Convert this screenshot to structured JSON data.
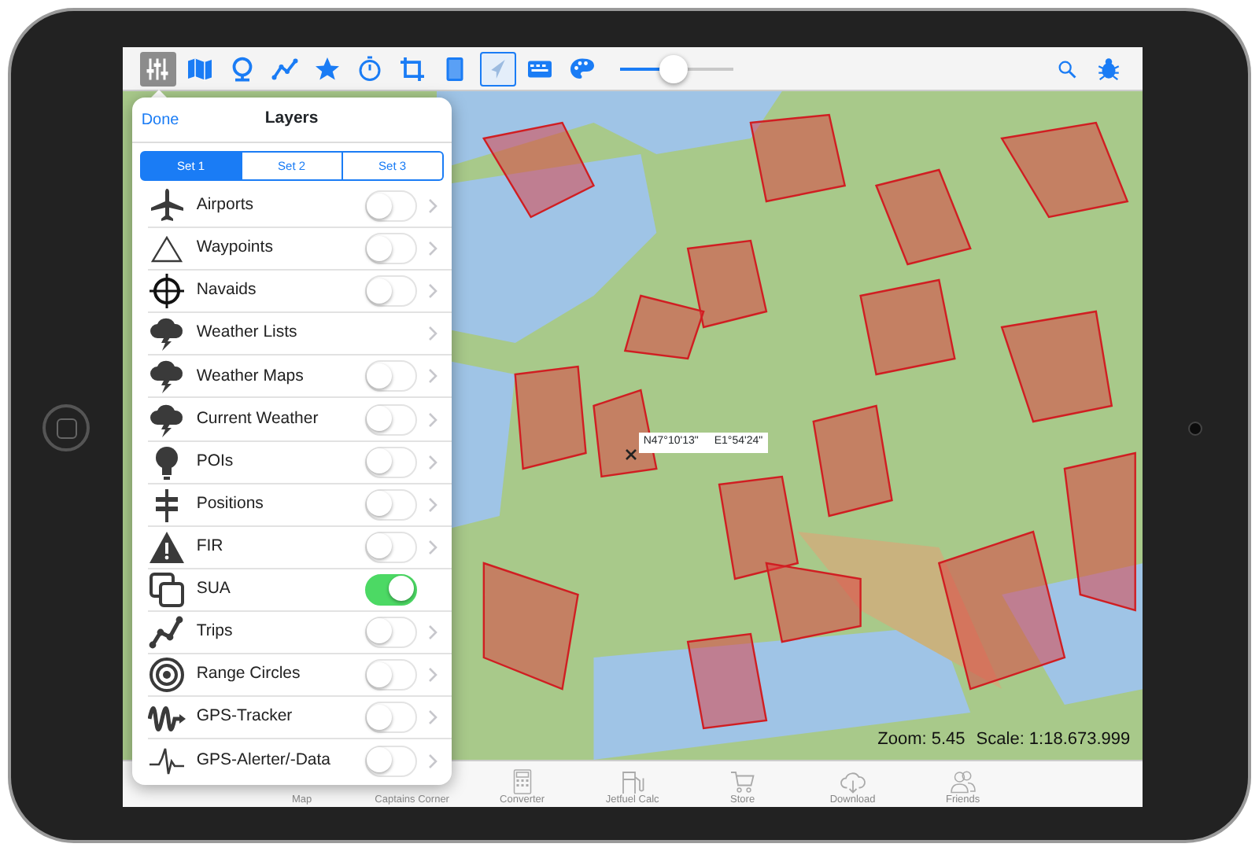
{
  "toolbar": {
    "buttons": [
      {
        "selected": true
      },
      {
        "selected": false
      },
      {
        "selected": false
      },
      {
        "selected": false
      },
      {
        "selected": false
      },
      {
        "selected": false
      },
      {
        "selected": false
      },
      {
        "selected": false
      },
      {
        "selected": true
      },
      {
        "selected": false
      },
      {
        "selected": false
      }
    ],
    "slider": {
      "level": 0.48
    }
  },
  "map": {
    "coordinates": {
      "lat": "N47°10'13\"",
      "lon": "E1°54'24\""
    },
    "zoom": "Zoom: 5.45",
    "scale": "Scale: 1:18.673.999"
  },
  "layers_panel": {
    "done": "Done",
    "title": "Layers",
    "sets": [
      {
        "label": "Set 1",
        "selected": true
      },
      {
        "label": "Set 2",
        "selected": false
      },
      {
        "label": "Set 3",
        "selected": false
      }
    ],
    "layers": [
      {
        "name": "Airports",
        "kind": "toggle_link",
        "on": false
      },
      {
        "name": "Waypoints",
        "kind": "toggle_link",
        "on": false
      },
      {
        "name": "Navaids",
        "kind": "toggle_link",
        "on": false
      },
      {
        "name": "Weather Lists",
        "kind": "link"
      },
      {
        "name": "Weather Maps",
        "kind": "toggle_link",
        "on": false
      },
      {
        "name": "Current Weather",
        "kind": "toggle_link",
        "on": false
      },
      {
        "name": "POIs",
        "kind": "toggle_link",
        "on": false
      },
      {
        "name": "Positions",
        "kind": "toggle_link",
        "on": false
      },
      {
        "name": "FIR",
        "kind": "toggle_link",
        "on": false
      },
      {
        "name": "SUA",
        "kind": "toggle",
        "on": true
      },
      {
        "name": "Trips",
        "kind": "toggle_link",
        "on": false
      },
      {
        "name": "Range Circles",
        "kind": "toggle_link",
        "on": false
      },
      {
        "name": "GPS-Tracker",
        "kind": "toggle_link",
        "on": false
      },
      {
        "name": "GPS-Alerter/-Data",
        "kind": "toggle_link",
        "on": false
      }
    ]
  },
  "tab_bar": {
    "items": [
      {
        "label": "Map"
      },
      {
        "label": "Captains Corner"
      },
      {
        "label": "Converter"
      },
      {
        "label": "Jetfuel Calc"
      },
      {
        "label": "Store"
      },
      {
        "label": "Download"
      },
      {
        "label": "Friends"
      }
    ]
  }
}
